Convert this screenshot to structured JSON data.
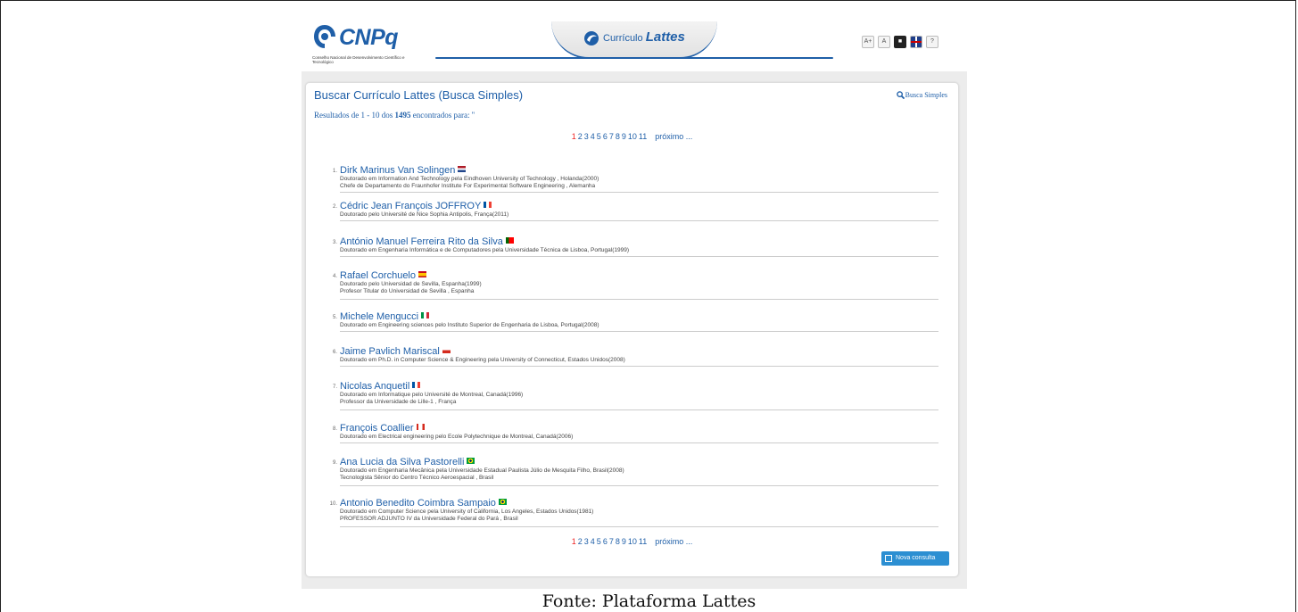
{
  "header": {
    "logo_text": "CNPq",
    "logo_subtitle": "Conselho Nacional de Desenvolvimento Científico e Tecnológico",
    "tab_prefix": "Currículo",
    "tab_name": "Lattes",
    "tools": [
      "A+",
      "A",
      "",
      "",
      "?"
    ]
  },
  "panel": {
    "title": "Buscar Currículo Lattes (Busca Simples)",
    "busca_link": "Busca Simples",
    "results_prefix": "Resultados de 1 - 10 dos",
    "results_count": "1495",
    "results_suffix": "encontrados para: ''"
  },
  "pager": {
    "pages": [
      "1",
      "2",
      "3",
      "4",
      "5",
      "6",
      "7",
      "8",
      "9",
      "10",
      "11"
    ],
    "current": "1",
    "next_label": "próximo ..."
  },
  "results": [
    {
      "num": "1.",
      "name": "Dirk Marinus Van Solingen",
      "flag": "netherlands",
      "lines": [
        "Doutorado em Information And Technology pela Eindhoven University of Technology , Holanda(2000)",
        "Chefe de Departamento do Fraunhofer Institute For Experimental Software Engineering , Alemanha"
      ]
    },
    {
      "num": "2.",
      "name": "Cédric Jean François JOFFROY",
      "flag": "france",
      "lines": [
        "Doutorado pelo Université de Nice Sophia Antipolis, França(2011)"
      ]
    },
    {
      "num": "3.",
      "name": "António Manuel Ferreira Rito da Silva",
      "flag": "portugal",
      "lines": [
        "Doutorado em Engenharia Informática e de Computadores pela Universidade Técnica de Lisboa, Portugal(1999)"
      ]
    },
    {
      "num": "4.",
      "name": "Rafael Corchuelo",
      "flag": "spain",
      "lines": [
        "Doutorado pelo Universidad de Sevilla, Espanha(1999)",
        "Profesor Titular do Universidad de Sevilla , Espanha"
      ]
    },
    {
      "num": "5.",
      "name": "Michele Mengucci",
      "flag": "italy",
      "lines": [
        "Doutorado em Engineering sciences pelo Instituto Superior de Engenharia de Lisboa, Portugal(2008)"
      ]
    },
    {
      "num": "6.",
      "name": "Jaime Pavlich Mariscal",
      "flag": "chile",
      "lines": [
        "Doutorado em Ph.D. in Computer Science & Engineering pela University of Connecticut, Estados Unidos(2008)"
      ]
    },
    {
      "num": "7.",
      "name": "Nicolas Anquetil",
      "flag": "france",
      "lines": [
        "Doutorado em Informatique pelo Université de Montreal, Canadá(1996)",
        "Professor da Universidade de Lille-1 , França"
      ]
    },
    {
      "num": "8.",
      "name": "François Coallier",
      "flag": "canada",
      "lines": [
        "Doutorado em Electrical engineering pelo Ecole Polytechnique de Montreal, Canadá(2006)"
      ]
    },
    {
      "num": "9.",
      "name": "Ana Lucia da Silva Pastorelli",
      "flag": "brazil",
      "lines": [
        "Doutorado em Engenharia Mecânica pela Universidade Estadual Paulista Júlio de Mesquita Filho, Brasil(2008)",
        "Tecnologista Sênior do Centro Técnico Aeroespacial , Brasil"
      ]
    },
    {
      "num": "10.",
      "name": "Antonio Benedito Coimbra Sampaio",
      "flag": "brazil",
      "lines": [
        "Doutorado em Computer Science pela University of California, Los Angeles, Estados Unidos(1981)",
        "PROFESSOR ADJUNTO IV da Universidade Federal do Pará , Brasil"
      ]
    }
  ],
  "nova_consulta": "Nova consulta",
  "caption": "Fonte: Plataforma Lattes",
  "colors": {
    "link": "#1f5fa8",
    "current_page": "#e22",
    "button": "#2c8fd2"
  }
}
